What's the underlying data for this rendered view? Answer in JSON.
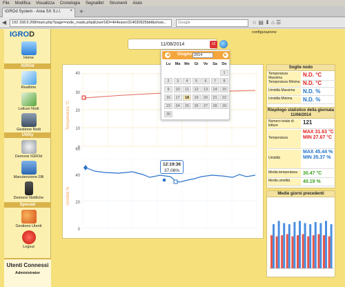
{
  "browser": {
    "menu": [
      "File",
      "Modifica",
      "Visualizza",
      "Cronologia",
      "Segnalibri",
      "Strumenti",
      "Aiuto"
    ],
    "tab_title": "IGROd System - Area SX S.r.l.",
    "url": "192.168.9.208/main.php?page=node_reads.php&UserSID=4rl4eavnr314030925bbf&show...",
    "search_placeholder": "Google"
  },
  "sidebar": {
    "logo_prefix": "IGRO",
    "logo_suffix": "D",
    "items": [
      {
        "label": "Home",
        "section_after": "IGROd"
      },
      {
        "label": "Realtime"
      },
      {
        "label": "Letture Nodi"
      },
      {
        "label": "Gestione Nodi",
        "section_after": "Utility"
      },
      {
        "label": "Demone IGROd"
      },
      {
        "label": "Manutenzione DB"
      },
      {
        "label": "Demone Notifiche",
        "section_after": "Speciali"
      },
      {
        "label": "Gestione Utenti"
      },
      {
        "label": "Logout"
      }
    ],
    "sections": [
      "IGROd",
      "Utility",
      "Speciali"
    ],
    "users_title": "Utenti Connessi",
    "users_name": "Administrator"
  },
  "top": {
    "config_link": "configurazione",
    "date_value": "11/08/2014",
    "calendar_badge": "12"
  },
  "calendar": {
    "month": "Giugno",
    "year": "2014",
    "dow": [
      "Lu",
      "Ma",
      "Me",
      "Gi",
      "Ve",
      "Sa",
      "Do"
    ],
    "weeks": [
      [
        "",
        "",
        "",
        "",
        "",
        "",
        "1"
      ],
      [
        "2",
        "3",
        "4",
        "5",
        "6",
        "7",
        "8"
      ],
      [
        "9",
        "10",
        "11",
        "12",
        "13",
        "14",
        "15"
      ],
      [
        "16",
        "17",
        "18",
        "19",
        "20",
        "21",
        "22"
      ],
      [
        "23",
        "24",
        "25",
        "26",
        "27",
        "28",
        "29"
      ],
      [
        "30",
        "",
        "",
        "",
        "",
        "",
        ""
      ]
    ],
    "selected": "18"
  },
  "charts": {
    "temp_ylabel": "Temperatura °C",
    "hum_ylabel": "Umidità %",
    "temp_ticks": [
      "40",
      "30",
      "20",
      "10",
      "0"
    ],
    "hum_ticks": [
      "40",
      "20",
      "0"
    ],
    "hum_top_tick": "60",
    "tooltip_time": "12:19:36",
    "tooltip_value": "37.06%"
  },
  "soglie": {
    "title": "Soglie nodo",
    "rows": [
      {
        "label": "Temperatura Massima",
        "value": "N.D. °C",
        "color": "red"
      },
      {
        "label": "Temperatura Minima",
        "value": "N.D. °C",
        "color": "red"
      },
      {
        "label": "Umidità Massima",
        "value": "N.D. %",
        "color": "blue"
      },
      {
        "label": "Umidità Minima",
        "value": "N.D. %",
        "color": "blue"
      }
    ]
  },
  "riepilogo": {
    "title": "Riepilogo statistico della giornata",
    "date": "11/06/2014",
    "letture_label": "Numero totale di letture",
    "letture": "121",
    "temp_label": "Temperatura",
    "temp_max": "MAX 31.63 °C",
    "temp_min": "MIN 27.67 °C",
    "hum_label": "Umidità",
    "hum_max": "MAX 45.44 %",
    "hum_min": "MIN 35.37 %",
    "media_temp_label": "Media temperatura",
    "media_temp": "30.47 °C",
    "media_hum_label": "Media umidità",
    "media_hum": "40.19 %"
  },
  "medie": {
    "title": "Medie giorni precedenti",
    "temp": [
      30,
      29,
      30,
      31,
      29,
      30,
      31,
      29,
      30,
      31,
      30,
      29
    ],
    "hum": [
      40,
      43,
      41,
      40,
      42,
      43,
      41,
      40,
      42,
      41,
      43,
      40
    ]
  },
  "colors": {
    "accent": "#f4a53c",
    "temp": "#e0201c",
    "hum": "#1f73c8"
  }
}
